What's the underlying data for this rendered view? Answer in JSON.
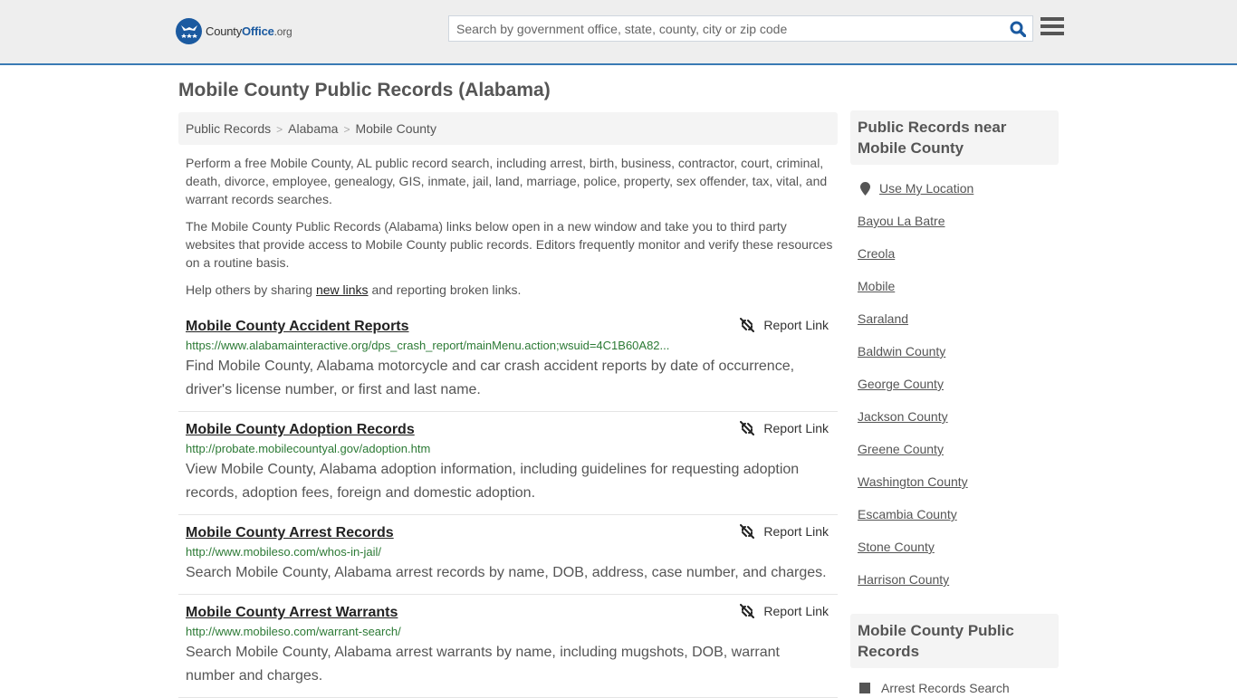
{
  "header": {
    "logo": {
      "county": "County",
      "office": "Office",
      "org": ".org"
    },
    "search_placeholder": "Search by government office, state, county, city or zip code",
    "search_value": ""
  },
  "page_title": "Mobile County Public Records (Alabama)",
  "breadcrumb": [
    "Public Records",
    "Alabama",
    "Mobile County"
  ],
  "intro": {
    "p1": "Perform a free Mobile County, AL public record search, including arrest, birth, business, contractor, court, criminal, death, divorce, employee, genealogy, GIS, inmate, jail, land, marriage, police, property, sex offender, tax, vital, and warrant records searches.",
    "p2": "The Mobile County Public Records (Alabama) links below open in a new window and take you to third party websites that provide access to Mobile County public records. Editors frequently monitor and verify these resources on a routine basis.",
    "p3_before": "Help others by sharing ",
    "p3_link": "new links",
    "p3_after": " and reporting broken links."
  },
  "report_label": "Report Link",
  "records": [
    {
      "title": "Mobile County Accident Reports",
      "url": "https://www.alabamainteractive.org/dps_crash_report/mainMenu.action;wsuid=4C1B60A82...",
      "desc": "Find Mobile County, Alabama motorcycle and car crash accident reports by date of occurrence, driver's license number, or first and last name."
    },
    {
      "title": "Mobile County Adoption Records",
      "url": "http://probate.mobilecountyal.gov/adoption.htm",
      "desc": "View Mobile County, Alabama adoption information, including guidelines for requesting adoption records, adoption fees, foreign and domestic adoption."
    },
    {
      "title": "Mobile County Arrest Records",
      "url": "http://www.mobileso.com/whos-in-jail/",
      "desc": "Search Mobile County, Alabama arrest records by name, DOB, address, case number, and charges."
    },
    {
      "title": "Mobile County Arrest Warrants",
      "url": "http://www.mobileso.com/warrant-search/",
      "desc": "Search Mobile County, Alabama arrest warrants by name, including mugshots, DOB, warrant number and charges."
    }
  ],
  "sidebar": {
    "nearby_heading": "Public Records near Mobile County",
    "use_location": "Use My Location",
    "nearby": [
      "Bayou La Batre",
      "Creola",
      "Mobile",
      "Saraland",
      "Baldwin County",
      "George County",
      "Jackson County",
      "Greene County",
      "Washington County",
      "Escambia County",
      "Stone County",
      "Harrison County"
    ],
    "records_heading": "Mobile County Public Records",
    "records_first": "Arrest Records Search"
  }
}
